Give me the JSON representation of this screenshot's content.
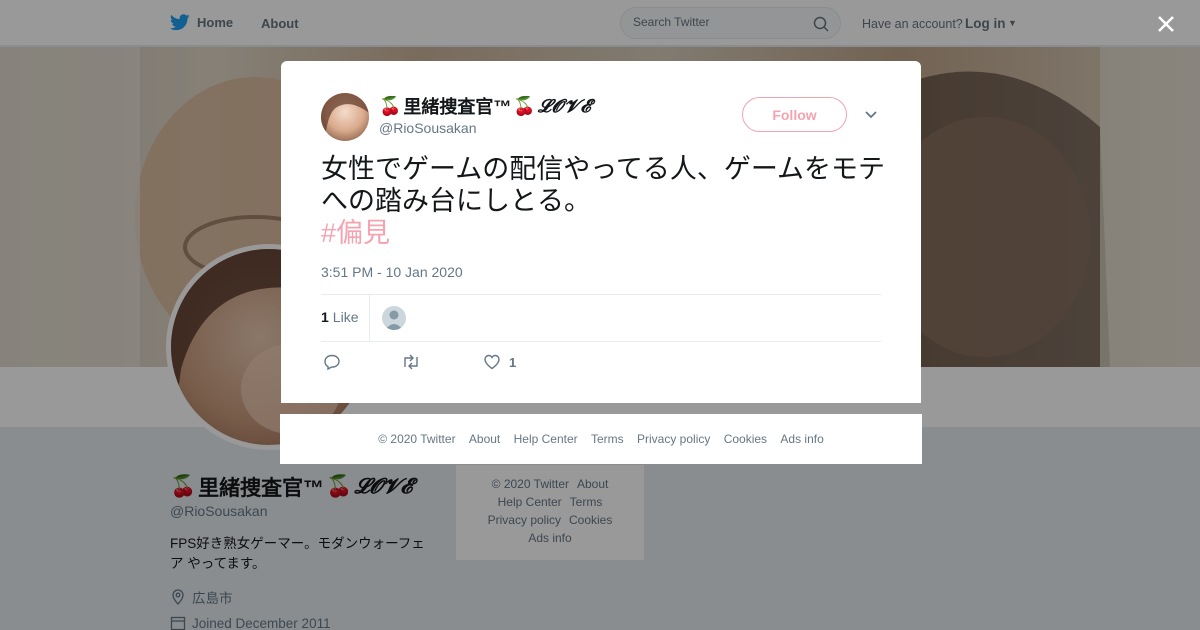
{
  "topbar": {
    "home_label": "Home",
    "about_label": "About",
    "search_placeholder": "Search Twitter",
    "have_account": "Have an account?",
    "login_label": "Log in"
  },
  "profile": {
    "name": "里緒捜査官™",
    "name_suffix": "𝓛𝓞𝓥𝓔",
    "handle": "@RioSousakan",
    "bio": "FPS好き熟女ゲーマー。モダンウォーフェア やってます。",
    "location": "広島市",
    "joined": "Joined December 2011"
  },
  "bg_footer": {
    "row1": [
      "© 2020 Twitter",
      "About"
    ],
    "row2": [
      "Help Center",
      "Terms"
    ],
    "row3": [
      "Privacy policy",
      "Cookies"
    ],
    "row4": [
      "Ads info"
    ]
  },
  "tweet": {
    "author_name": "里緒捜査官™",
    "author_suffix": "𝓛𝓞𝓥𝓔",
    "author_handle": "@RioSousakan",
    "follow_label": "Follow",
    "text": "女性でゲームの配信やってる人、ゲームをモテへの踏み台にしとる。",
    "hashtag": "#偏見",
    "timestamp": "3:51 PM - 10 Jan 2020",
    "like_count": "1",
    "like_label": "Like",
    "action_like_count": "1"
  },
  "modal_footer": [
    "© 2020 Twitter",
    "About",
    "Help Center",
    "Terms",
    "Privacy policy",
    "Cookies",
    "Ads info"
  ],
  "colors": {
    "accent_pink": "#f4a3b0",
    "twitter_blue": "#1da1f2",
    "muted": "#657786",
    "overlay": "rgba(0,0,0,0.40)"
  },
  "icons": [
    "twitter-bird-icon",
    "search-icon",
    "caret-down-icon",
    "close-icon",
    "cherry-icon",
    "location-icon",
    "calendar-icon",
    "reply-icon",
    "retweet-icon",
    "heart-icon",
    "chevron-down-icon"
  ]
}
